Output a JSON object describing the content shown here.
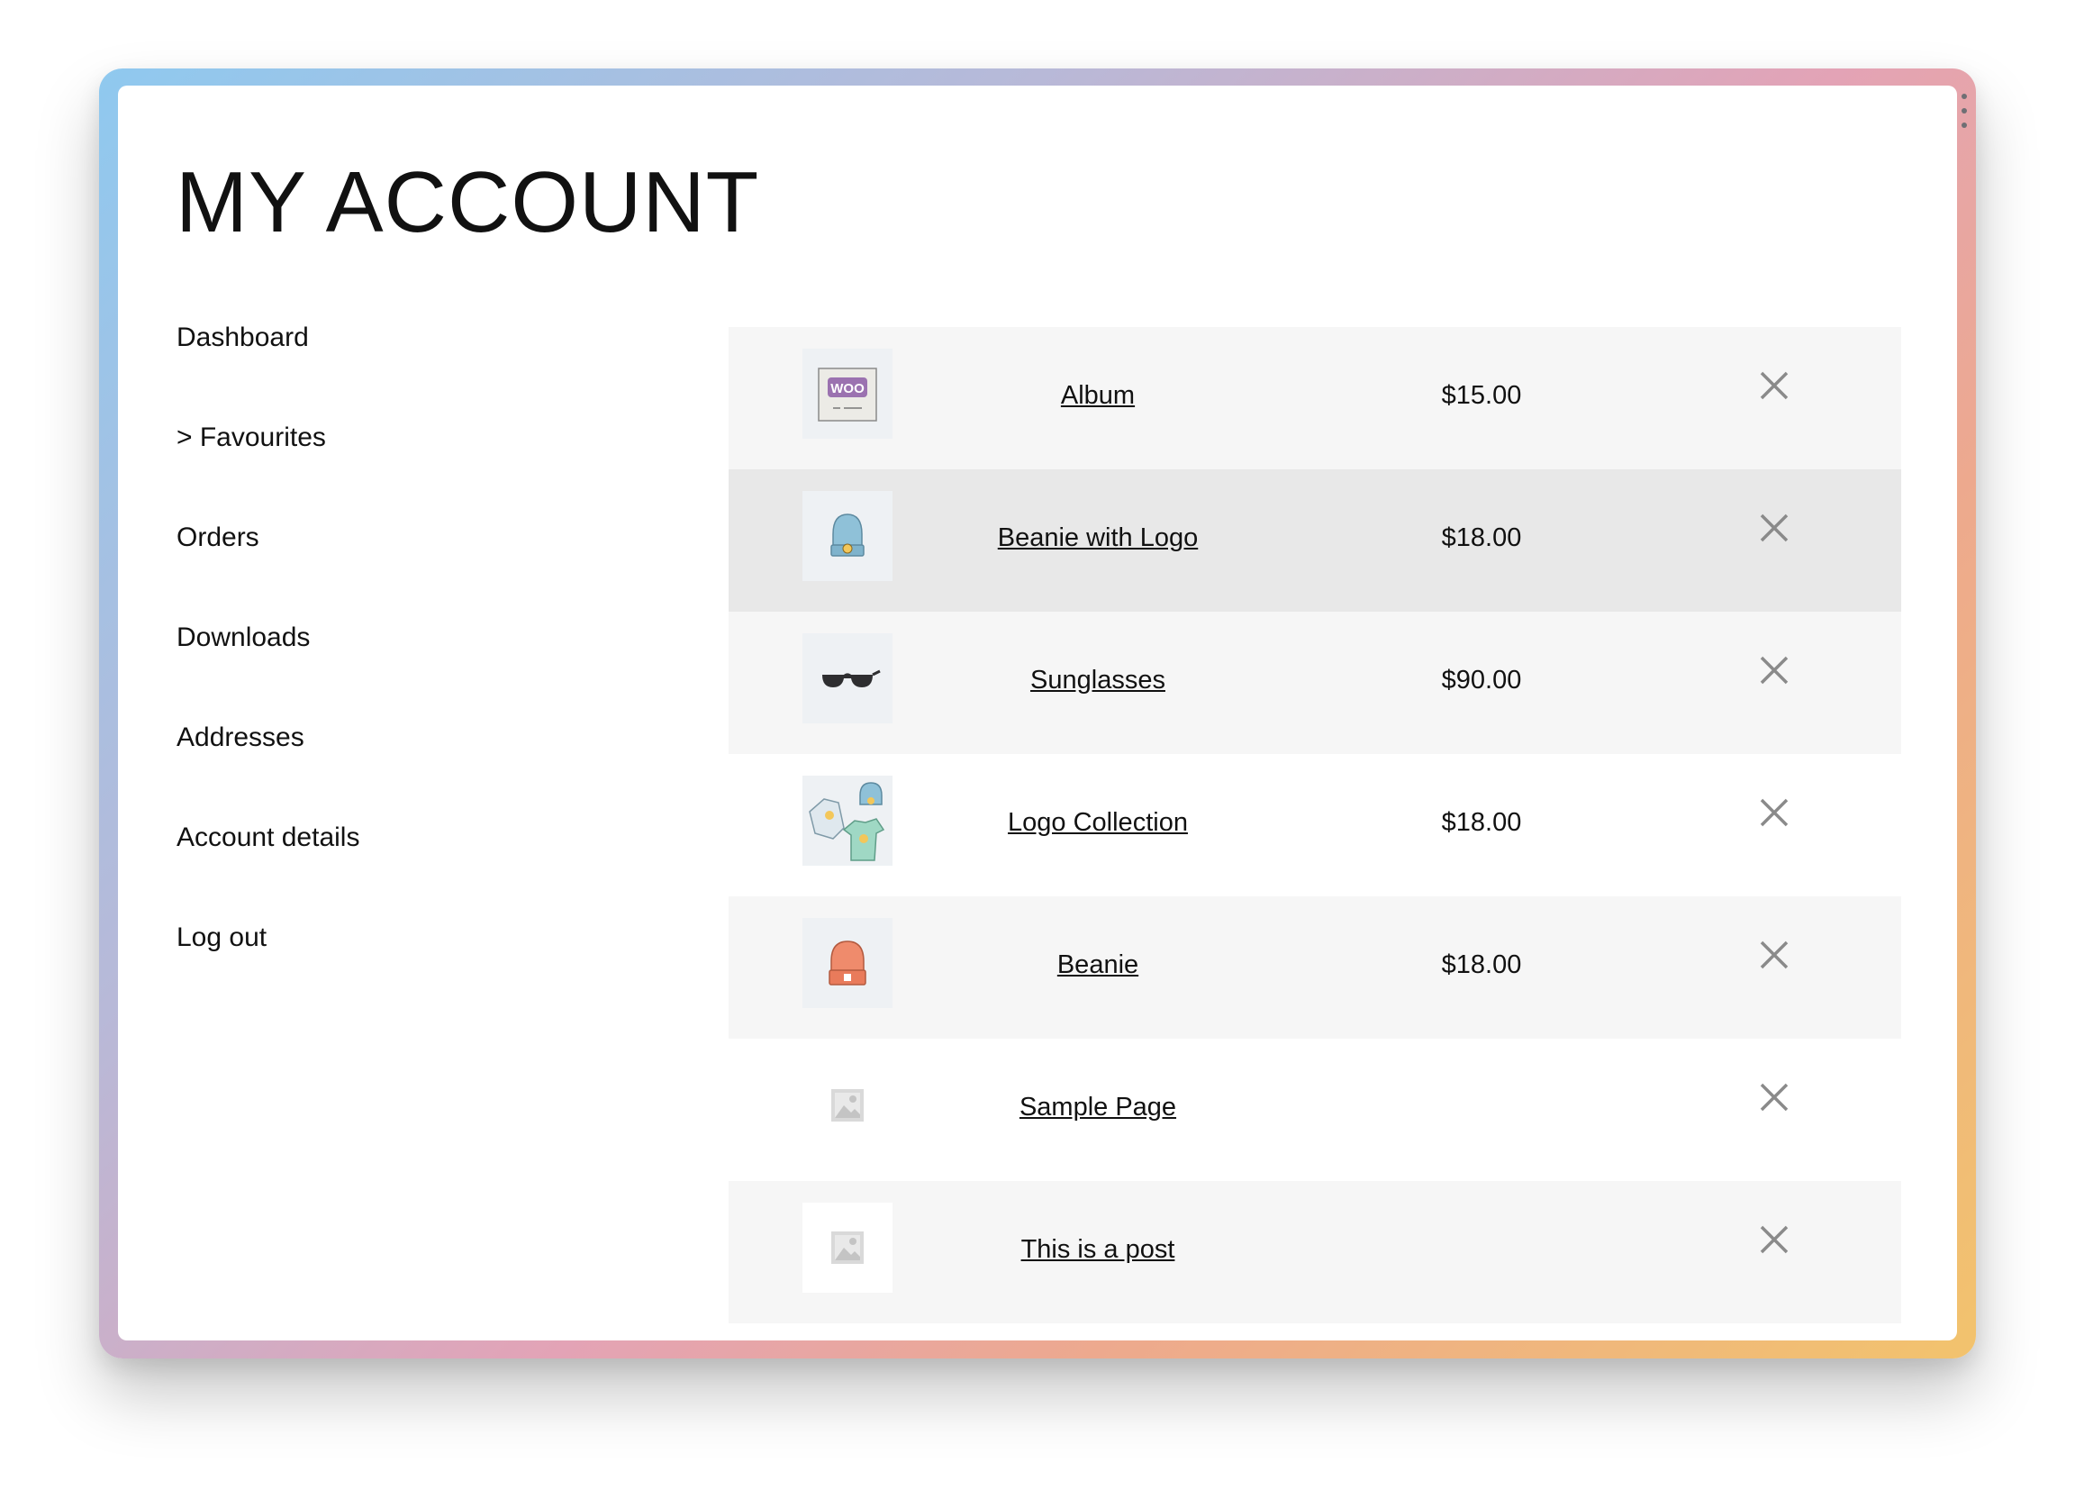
{
  "page": {
    "title": "MY ACCOUNT"
  },
  "nav": [
    {
      "label": "Dashboard"
    },
    {
      "label": "> Favourites"
    },
    {
      "label": "Orders"
    },
    {
      "label": "Downloads"
    },
    {
      "label": "Addresses"
    },
    {
      "label": "Account details"
    },
    {
      "label": "Log out"
    }
  ],
  "wishlist": {
    "items": [
      {
        "name": "Album",
        "price": "$15.00",
        "image": "album-thumbnail",
        "remove_icon": "close-icon"
      },
      {
        "name": "Beanie with Logo",
        "price": "$18.00",
        "image": "beanie-with-logo-thumbnail",
        "remove_icon": "close-icon"
      },
      {
        "name": "Sunglasses",
        "price": "$90.00",
        "image": "sunglasses-thumbnail",
        "remove_icon": "close-icon"
      },
      {
        "name": "Logo Collection",
        "price": "$18.00",
        "image": "logo-collection-thumbnail",
        "remove_icon": "close-icon"
      },
      {
        "name": "Beanie",
        "price": "$18.00",
        "image": "beanie-thumbnail",
        "remove_icon": "close-icon"
      },
      {
        "name": "Sample Page",
        "price": "",
        "image": "placeholder-image-icon",
        "remove_icon": "close-icon"
      },
      {
        "name": "This is a post",
        "price": "",
        "image": "placeholder-image-icon",
        "remove_icon": "close-icon"
      }
    ]
  },
  "colors": {
    "row_bg": "#f6f6f6",
    "row_hover_bg": "#e8e8e8",
    "text": "#111111",
    "remove_icon": "#8a8a8a"
  }
}
